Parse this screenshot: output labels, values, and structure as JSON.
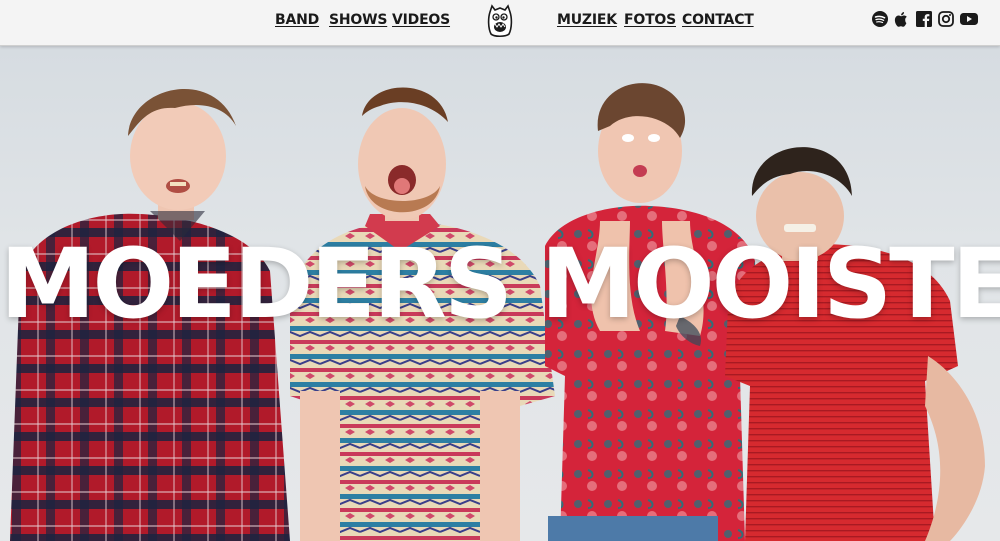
{
  "nav": {
    "left_links": [
      "BAND",
      "SHOWS",
      "VIDEOS"
    ],
    "right_links": [
      "MUZIEK",
      "FOTOS",
      "CONTACT"
    ],
    "logo_icon": "monster-logo-icon",
    "social_icons": [
      "spotify-icon",
      "apple-icon",
      "facebook-icon",
      "instagram-icon",
      "youtube-icon"
    ]
  },
  "hero": {
    "title": "MOEDERS MOOISTE"
  },
  "colors": {
    "nav_bg": "#f4f4f4",
    "text": "#1a1a1a",
    "title": "#ffffff",
    "flannel_red": "#b11a2a",
    "flannel_navy": "#1c2340",
    "shirt_red": "#d42a2e"
  }
}
